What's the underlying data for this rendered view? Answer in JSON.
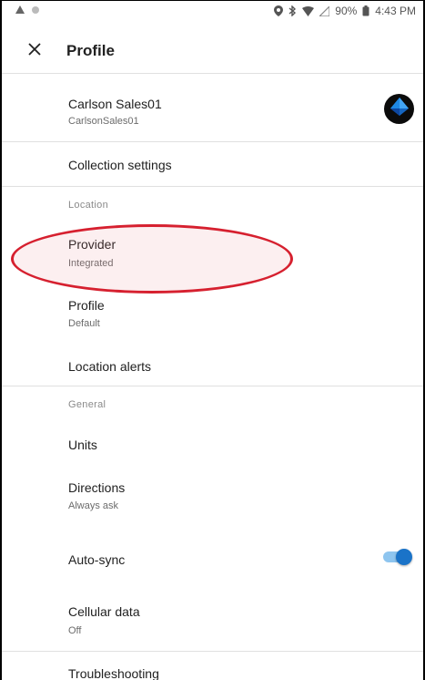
{
  "status_bar": {
    "battery": "90%",
    "time": "4:43 PM"
  },
  "app_bar": {
    "title": "Profile"
  },
  "account": {
    "name": "Carlson Sales01",
    "username": "CarlsonSales01"
  },
  "collection_settings": {
    "label": "Collection settings"
  },
  "location_section": {
    "label": "Location",
    "provider": {
      "title": "Provider",
      "value": "Integrated"
    },
    "profile": {
      "title": "Profile",
      "value": "Default"
    },
    "alerts": {
      "title": "Location alerts"
    }
  },
  "general_section": {
    "label": "General",
    "units": {
      "title": "Units"
    },
    "directions": {
      "title": "Directions",
      "value": "Always ask"
    },
    "auto_sync": {
      "title": "Auto-sync",
      "enabled": true
    },
    "cellular": {
      "title": "Cellular data",
      "value": "Off"
    }
  },
  "troubleshooting": {
    "label": "Troubleshooting"
  },
  "colors": {
    "accent": "#1a73c8",
    "annotation": "#d6202f"
  }
}
